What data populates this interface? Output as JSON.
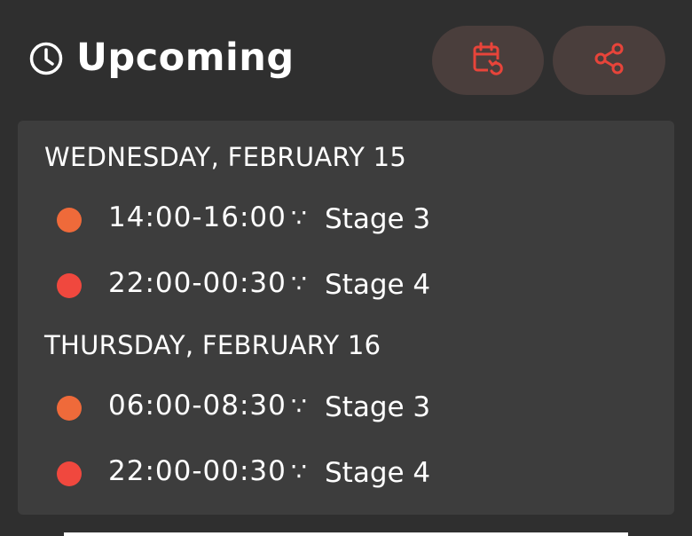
{
  "header": {
    "title": "Upcoming",
    "icon": "clock-icon",
    "actions": [
      {
        "name": "calendar-refresh",
        "icon": "calendar-refresh-icon"
      },
      {
        "name": "share",
        "icon": "share-icon"
      }
    ]
  },
  "colors": {
    "background": "#2f2f2f",
    "card": "#3d3d3d",
    "button_bg": "#4a3e3c",
    "accent_red": "#e8443a",
    "dot_stage3": "#ef6a3a",
    "dot_stage4": "#f0483e"
  },
  "schedule": [
    {
      "day": "WEDNESDAY, FEBRUARY 15",
      "slots": [
        {
          "time": "14:00-16:00",
          "sep": "∵",
          "stage": "Stage 3"
        },
        {
          "time": "22:00-00:30",
          "sep": "∵",
          "stage": "Stage 4"
        }
      ]
    },
    {
      "day": "THURSDAY, FEBRUARY 16",
      "slots": [
        {
          "time": "06:00-08:30",
          "sep": "∵",
          "stage": "Stage 3"
        },
        {
          "time": "22:00-00:30",
          "sep": "∵",
          "stage": "Stage 4"
        }
      ]
    }
  ]
}
